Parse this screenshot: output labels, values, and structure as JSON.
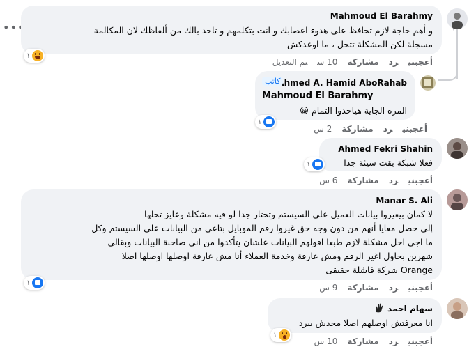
{
  "actions": {
    "like": "أعجبني",
    "reply": "رد",
    "share": "مشاركة",
    "edited": "تم التعديل"
  },
  "comments": [
    {
      "name": "Mahmoud El Barahmy",
      "lines": [
        "و أهم حاجة لازم تحافظ على هدوء اعصابك و انت بتكلمهم و تاخد بالك من ألفاظك لان المكالمة",
        "مسجلة لكن المشكلة تتحل ، ما اوعدكش"
      ],
      "time": "10 س",
      "reaction_count": "١",
      "reaction": "haha-emoji"
    },
    {
      "name": "Ahmed A. Hamid AboRahab",
      "badge": "كاتب",
      "mention": "Mahmoud El Barahmy",
      "text": "المرة الجاية هياخدوا التمام 😀",
      "time": "2 س",
      "reaction_count": "١"
    },
    {
      "name": "Ahmed Fekri Shahin",
      "text": "فعلا شبكة بقت سيئة جدا",
      "time": "6 س",
      "reaction_count": "١"
    },
    {
      "name": "Manar S. Ali",
      "lines": [
        "لا كمان بيغيروا بيانات العميل على السيستم وتحتار جدا لو فيه مشكلة وعايز تحلها",
        "إلى حصل معايا أنهم من دون وجه حق غيروا رقم الموبايل بتاعي من البيانات على السيستم وكل",
        "ما اجى احل مشكلة لازم طبعا اقولهم البيانات علشان يتأكدوا من انى صاحبة البيانات وبقالى",
        "شهرين بحاول اغير الرقم ومش عارفة وخدمة العملاء أنا مش عارفة اوصلها اوصلها اصلا",
        "Orange شركة فاشلة حقيقى"
      ],
      "time": "9 س",
      "reaction_count": "١"
    },
    {
      "name": "سهام احمد",
      "text": "انا معرفتش اوصلهم اصلا محدش بيرد",
      "time": "10 س",
      "reaction_count": "١",
      "reaction": "wow-emoji"
    }
  ],
  "colors": {
    "bubble": "#f0f2f5",
    "like": "#1877f2",
    "muted": "#65676b"
  }
}
